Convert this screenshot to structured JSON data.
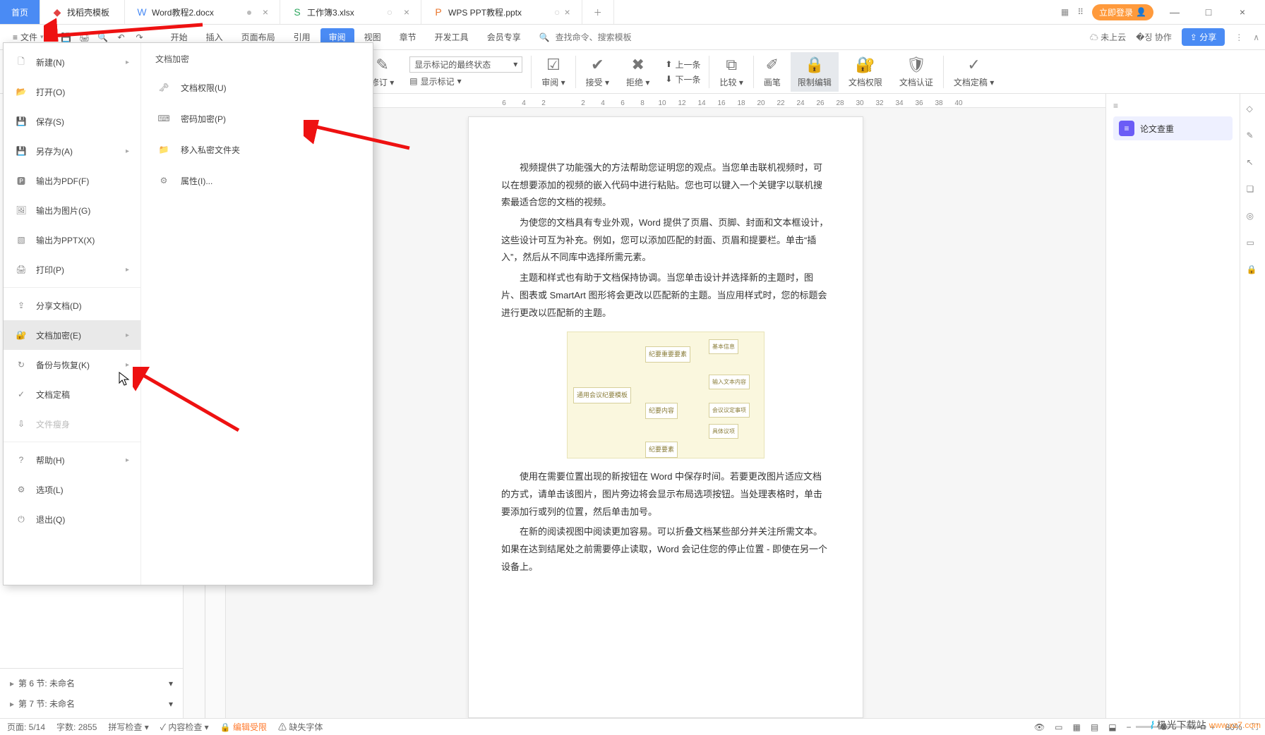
{
  "tabs": {
    "home": "首页",
    "t1": "找稻壳模板",
    "t2": "Word教程2.docx",
    "t3": "工作簿3.xlsx",
    "t4": "WPS PPT教程.pptx"
  },
  "title_right": {
    "login": "立即登录",
    "minimize": "—",
    "maximize": "□",
    "close": "×"
  },
  "menubar": {
    "file": "文件",
    "tabs": [
      "开始",
      "插入",
      "页面布局",
      "引用",
      "审阅",
      "视图",
      "章节",
      "开发工具",
      "会员专享"
    ],
    "active_index": 4,
    "search_ph": "查找命令、搜索模板",
    "cloud": "未上云",
    "coop": "协作",
    "share": "分享"
  },
  "ribbon": {
    "prev": "上一条",
    "next": "下一条",
    "revise": "修订",
    "track_sel": "显示标记的最终状态",
    "show_marks": "显示标记",
    "review": "审阅",
    "accept": "接受",
    "reject": "拒绝",
    "nav_prev": "上一条",
    "nav_next": "下一条",
    "compare": "比较",
    "pen": "画笔",
    "restrict": "限制编辑",
    "docperm": "文档权限",
    "doccert": "文档认证",
    "docdraft": "文档定稿"
  },
  "filemenu": {
    "items": [
      {
        "label": "新建(N)",
        "arrow": true
      },
      {
        "label": "打开(O)"
      },
      {
        "label": "保存(S)"
      },
      {
        "label": "另存为(A)",
        "arrow": true
      },
      {
        "label": "输出为PDF(F)"
      },
      {
        "label": "输出为图片(G)"
      },
      {
        "label": "输出为PPTX(X)"
      },
      {
        "label": "打印(P)",
        "arrow": true
      },
      {
        "sep": true
      },
      {
        "label": "分享文档(D)"
      },
      {
        "label": "文档加密(E)",
        "arrow": true,
        "hl": true
      },
      {
        "label": "备份与恢复(K)",
        "arrow": true
      },
      {
        "label": "文档定稿"
      },
      {
        "label": "文件瘦身",
        "disabled": true
      },
      {
        "sep": true
      },
      {
        "label": "帮助(H)",
        "arrow": true
      },
      {
        "label": "选项(L)"
      },
      {
        "label": "退出(Q)"
      }
    ],
    "submenu_title": "文档加密",
    "submenu": [
      {
        "label": "文档权限(U)"
      },
      {
        "label": "密码加密(P)"
      },
      {
        "label": "移入私密文件夹"
      },
      {
        "label": "属性(I)..."
      }
    ]
  },
  "ruler": [
    "6",
    "4",
    "2",
    "",
    "2",
    "4",
    "6",
    "8",
    "10",
    "12",
    "14",
    "16",
    "18",
    "20",
    "22",
    "24",
    "26",
    "28",
    "30",
    "32",
    "34",
    "36",
    "38",
    "40"
  ],
  "doc": {
    "p1": "视频提供了功能强大的方法帮助您证明您的观点。当您单击联机视频时，可以在想要添加的视频的嵌入代码中进行粘贴。您也可以键入一个关键字以联机搜索最适合您的文档的视频。",
    "p2": "为使您的文档具有专业外观，Word 提供了页眉、页脚、封面和文本框设计，这些设计可互为补充。例如，您可以添加匹配的封面、页眉和提要栏。单击“插入”，然后从不同库中选择所需元素。",
    "p3": "主题和样式也有助于文档保持协调。当您单击设计并选择新的主题时，图片、图表或 SmartArt 图形将会更改以匹配新的主题。当应用样式时，您的标题会进行更改以匹配新的主题。",
    "p4": "使用在需要位置出现的新按钮在 Word 中保存时间。若要更改图片适应文档的方式，请单击该图片，图片旁边将会显示布局选项按钮。当处理表格时，单击要添加行或列的位置，然后单击加号。",
    "p5": "在新的阅读视图中阅读更加容易。可以折叠文档某些部分并关注所需文本。如果在达到结尾处之前需要停止读取，Word 会记住您的停止位置 - 即使在另一个设备上。",
    "mm_center": "通用会议纪要模板",
    "mm_nodes": [
      "纪要重要要素",
      "纪要内容",
      "基本信息",
      "输入文本内容",
      "会议议定事项",
      "具体议项",
      "纪要要素"
    ]
  },
  "rightpanel": {
    "collapse": "≡",
    "item1": "论文查重"
  },
  "sections": {
    "s1": "第 6 节: 未命名",
    "s2": "第 7 节: 未命名"
  },
  "status": {
    "page": "页面: 5/14",
    "words": "字数: 2855",
    "spell": "拼写检查",
    "content": "内容检查",
    "editlock": "编辑受限",
    "missfont": "缺失字体",
    "zoom": "80%"
  },
  "watermark": {
    "brand": "极光下载站",
    "url": "www.xz7.com"
  }
}
